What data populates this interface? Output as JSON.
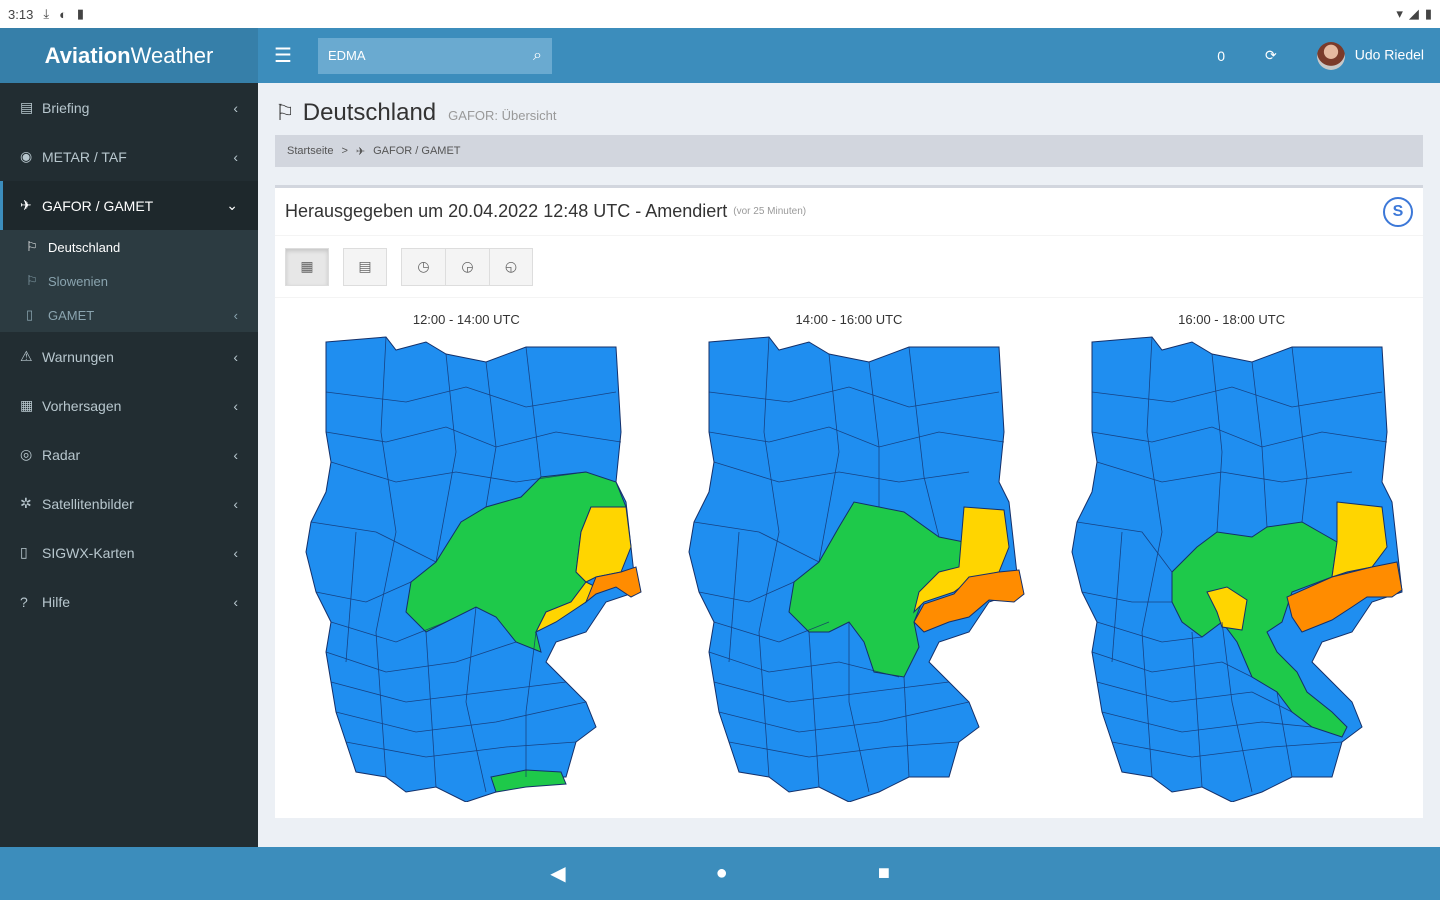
{
  "status": {
    "time": "3:13",
    "left_icons": [
      "download-icon",
      "vpn-icon",
      "clipboard-icon"
    ],
    "right_icons": [
      "wifi-icon",
      "signal-icon",
      "battery-icon"
    ]
  },
  "app": {
    "logo_bold": "Aviation",
    "logo_light": "Weather"
  },
  "topbar": {
    "search_value": "EDMA",
    "badge": "0",
    "user_name": "Udo Riedel"
  },
  "sidebar": {
    "items": [
      {
        "label": "Briefing",
        "icon": "briefcase-icon"
      },
      {
        "label": "METAR / TAF",
        "icon": "eye-icon"
      },
      {
        "label": "GAFOR / GAMET",
        "icon": "plane-icon"
      },
      {
        "label": "Warnungen",
        "icon": "warning-icon"
      },
      {
        "label": "Vorhersagen",
        "icon": "calendar-icon"
      },
      {
        "label": "Radar",
        "icon": "radar-icon"
      },
      {
        "label": "Satellitenbilder",
        "icon": "satellite-icon"
      },
      {
        "label": "SIGWX-Karten",
        "icon": "document-icon"
      },
      {
        "label": "Hilfe",
        "icon": "help-icon"
      }
    ],
    "subitems": [
      {
        "label": "Deutschland",
        "icon": "flag-icon"
      },
      {
        "label": "Slowenien",
        "icon": "flag-icon"
      },
      {
        "label": "GAMET",
        "icon": "document-icon"
      }
    ]
  },
  "page": {
    "title": "Deutschland",
    "subtitle": "GAFOR: Übersicht"
  },
  "breadcrumb": {
    "home": "Startseite",
    "separator": ">",
    "current": "GAFOR / GAMET"
  },
  "box": {
    "issued": "Herausgegeben um 20.04.2022 12:48 UTC - Amendiert",
    "ago": "(vor 25 Minuten)",
    "dwd_symbol": "S"
  },
  "maps": [
    {
      "title": "12:00 - 14:00 UTC"
    },
    {
      "title": "14:00 - 16:00 UTC"
    },
    {
      "title": "16:00 - 18:00 UTC"
    }
  ],
  "colors": {
    "blue": "#1f8ef0",
    "green": "#1ec94a",
    "yellow": "#ffd500",
    "orange": "#ff8c00"
  }
}
